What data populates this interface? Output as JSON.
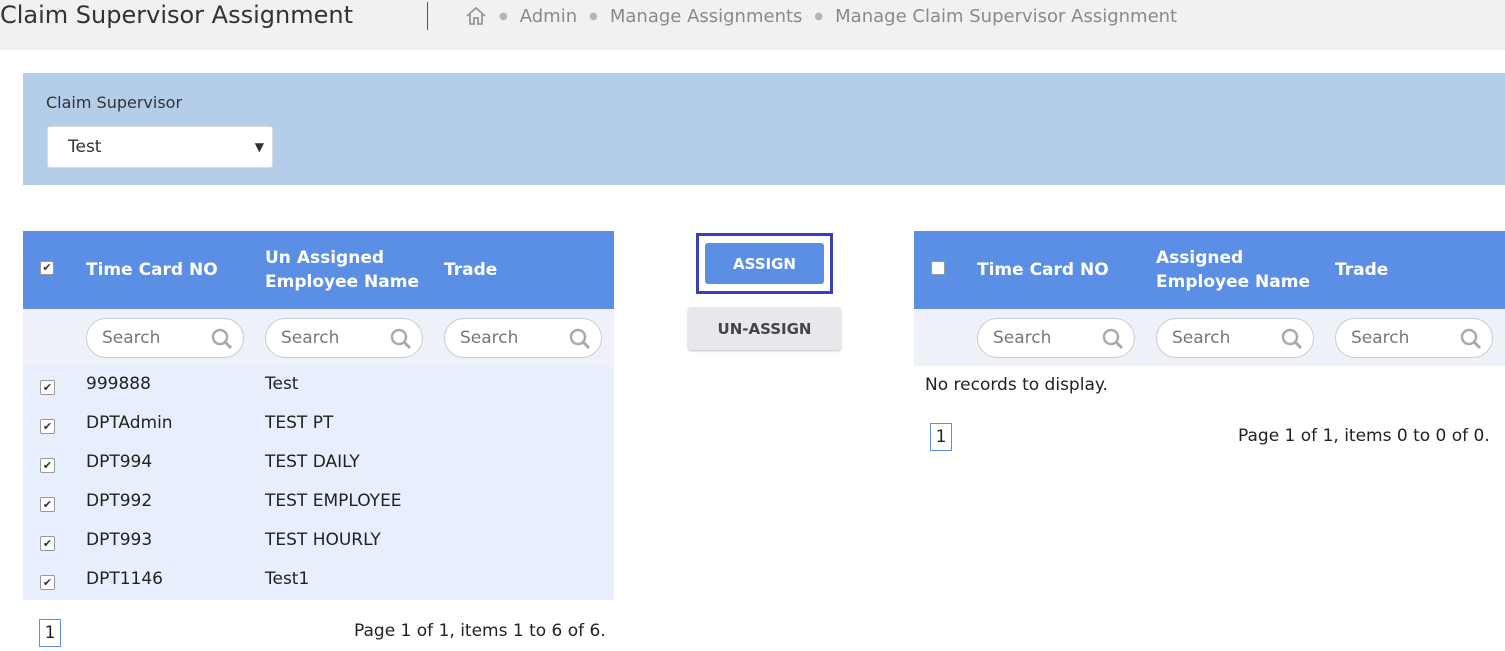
{
  "header": {
    "title": "Claim Supervisor Assignment",
    "breadcrumb": [
      "Admin",
      "Manage Assignments",
      "Manage Claim Supervisor Assignment"
    ]
  },
  "filter": {
    "label": "Claim Supervisor",
    "selected": "Test"
  },
  "unassigned_grid": {
    "header_checked": true,
    "columns": [
      "Time Card NO",
      "Un Assigned Employee Name",
      "Trade"
    ],
    "search_placeholder": "Search",
    "rows": [
      {
        "time_card": "999888",
        "name": "Test",
        "trade": "",
        "checked": true
      },
      {
        "time_card": "DPTAdmin",
        "name": "TEST PT",
        "trade": "",
        "checked": true
      },
      {
        "time_card": "DPT994",
        "name": "TEST DAILY",
        "trade": "",
        "checked": true
      },
      {
        "time_card": "DPT992",
        "name": "TEST EMPLOYEE",
        "trade": "",
        "checked": true
      },
      {
        "time_card": "DPT993",
        "name": "TEST HOURLY",
        "trade": "",
        "checked": true
      },
      {
        "time_card": "DPT1146",
        "name": "Test1",
        "trade": "",
        "checked": true
      }
    ],
    "page": "1",
    "page_info": "Page 1 of 1, items 1 to 6 of 6."
  },
  "actions": {
    "assign": "ASSIGN",
    "unassign": "UN-ASSIGN"
  },
  "assigned_grid": {
    "header_checked": false,
    "columns": [
      "Time Card NO",
      "Assigned Employee Name",
      "Trade"
    ],
    "search_placeholder": "Search",
    "empty_message": "No records to display.",
    "page": "1",
    "page_info": "Page 1 of 1, items 0 to 0 of 0."
  },
  "colors": {
    "grid_header": "#5b8fe6",
    "filter_panel": "#b4cde8",
    "assign_highlight": "#3b3fb5"
  }
}
